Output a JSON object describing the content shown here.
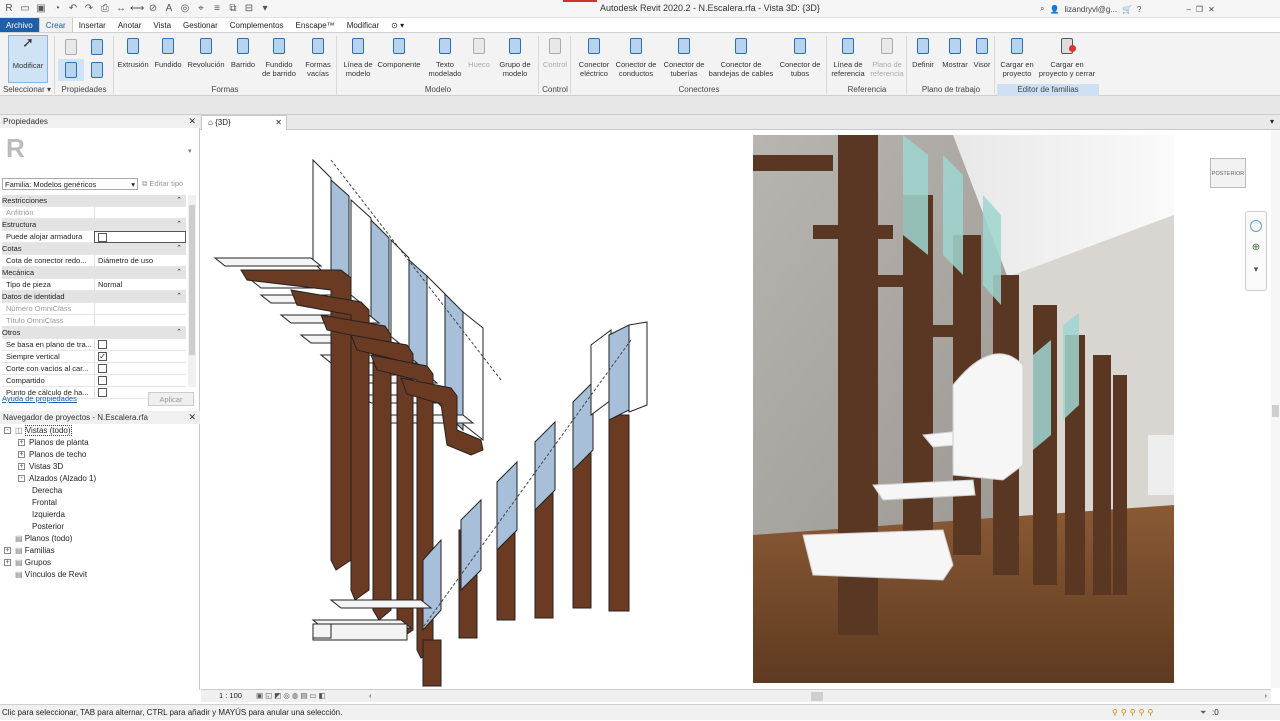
{
  "title_bar": {
    "title": "Autodesk Revit 2020.2 -  N.Escalera.rfa - Vista 3D: {3D}",
    "user": "lizandryvl@g...",
    "help": "?"
  },
  "menu": [
    "Archivo",
    "Crear",
    "Insertar",
    "Anotar",
    "Vista",
    "Gestionar",
    "Complementos",
    "Enscape™",
    "Modificar"
  ],
  "ribbon": {
    "modificar": "Modificar",
    "tools": [
      {
        "label": "Extrusión",
        "icon": "extrusion-icon"
      },
      {
        "label": "Fundido",
        "icon": "blend-icon"
      },
      {
        "label": "Revolución",
        "icon": "revolve-icon"
      },
      {
        "label": "Barrido",
        "icon": "sweep-icon"
      },
      {
        "label": "Fundido\nde barrido",
        "icon": "swept-blend-icon"
      },
      {
        "label": "Formas\nvacías",
        "icon": "void-forms-icon"
      },
      {
        "label": "Línea de\nmodelo",
        "icon": "model-line-icon"
      },
      {
        "label": "Componente",
        "icon": "component-icon"
      },
      {
        "label": "Texto\nmodelado",
        "icon": "model-text-icon"
      },
      {
        "label": "Hueco",
        "icon": "opening-icon"
      },
      {
        "label": "Grupo de\nmodelo",
        "icon": "model-group-icon"
      },
      {
        "label": "Control",
        "icon": "control-icon"
      },
      {
        "label": "Conector\neléctrico",
        "icon": "electrical-connector-icon"
      },
      {
        "label": "Conector de\nconductos",
        "icon": "duct-connector-icon"
      },
      {
        "label": "Conector de\ntuberías",
        "icon": "pipe-connector-icon"
      },
      {
        "label": "Conector de\nbandejas de cables",
        "icon": "cable-tray-connector-icon"
      },
      {
        "label": "Conector de\ntubos",
        "icon": "conduit-connector-icon"
      },
      {
        "label": "Línea de\nreferencia",
        "icon": "reference-line-icon"
      },
      {
        "label": "Plano de\nreferencia",
        "icon": "reference-plane-icon"
      },
      {
        "label": "Definir",
        "icon": "set-workplane-icon"
      },
      {
        "label": "Mostrar",
        "icon": "show-workplane-icon"
      },
      {
        "label": "Visor",
        "icon": "viewer-icon"
      },
      {
        "label": "Cargar en\nproyecto",
        "icon": "load-into-project-icon"
      },
      {
        "label": "Cargar en\nproyecto y cerrar",
        "icon": "load-and-close-icon"
      }
    ],
    "groups": [
      "Seleccionar ▾",
      "Propiedades",
      "Formas",
      "Modelo",
      "Control",
      "Conectores",
      "Referencia",
      "Plano de trabajo",
      "Editor de familias"
    ]
  },
  "properties": {
    "header": "Propiedades",
    "family_select": "Familia: Modelos genéricos",
    "edit_type": "Editar tipo",
    "rows": [
      {
        "k": "Restricciones",
        "cat": true
      },
      {
        "k": "Anfitrión",
        "v": "",
        "dim": true
      },
      {
        "k": "Estructura",
        "cat": true
      },
      {
        "k": "Puede alojar armadura",
        "chk": false
      },
      {
        "k": "Cotas",
        "cat": true
      },
      {
        "k": "Cota de conector redo...",
        "v": "Diámetro de uso"
      },
      {
        "k": "Mecánica",
        "cat": true
      },
      {
        "k": "Tipo de pieza",
        "v": "Normal"
      },
      {
        "k": "Datos de identidad",
        "cat": true
      },
      {
        "k": "Número OmniClass",
        "v": "",
        "dim": true
      },
      {
        "k": "Título OmniClass",
        "v": "",
        "dim": true
      },
      {
        "k": "Otros",
        "cat": true
      },
      {
        "k": "Se basa en plano de tra...",
        "chk": false
      },
      {
        "k": "Siempre vertical",
        "chk": true
      },
      {
        "k": "Corte con vacíos al car...",
        "chk": false
      },
      {
        "k": "Compartido",
        "chk": false
      },
      {
        "k": "Punto de cálculo de ha...",
        "chk": false
      }
    ],
    "help_link": "Ayuda de propiedades",
    "apply": "Aplicar"
  },
  "browser": {
    "header": "Navegador de proyectos - N.Escalera.rfa",
    "items": [
      {
        "label": "Vistas (todo)",
        "level": 0,
        "pm": "-",
        "icon": true
      },
      {
        "label": "Planos de planta",
        "level": 1,
        "pm": "+"
      },
      {
        "label": "Planos de techo",
        "level": 1,
        "pm": "+"
      },
      {
        "label": "Vistas 3D",
        "level": 1,
        "pm": "+"
      },
      {
        "label": "Alzados (Alzado 1)",
        "level": 1,
        "pm": "-"
      },
      {
        "label": "Derecha",
        "level": 2
      },
      {
        "label": "Frontal",
        "level": 2
      },
      {
        "label": "Izquierda",
        "level": 2
      },
      {
        "label": "Posterior",
        "level": 2
      },
      {
        "label": "Planos (todo)",
        "level": 0,
        "pm": ""
      },
      {
        "label": "Familias",
        "level": 0,
        "pm": "+"
      },
      {
        "label": "Grupos",
        "level": 0,
        "pm": "+"
      },
      {
        "label": "Vínculos de Revit",
        "level": 0,
        "pm": ""
      }
    ]
  },
  "view": {
    "tab": "{3D}",
    "scale": "1 : 100",
    "viewcube_face": "POSTERIOR"
  },
  "status": {
    "text": "Clic para seleccionar, TAB para alternar, CTRL para añadir y MAYÚS para anular una selección.",
    "filter_count": ":0"
  },
  "colors": {
    "accent": "#1f5fa8",
    "wood": "#6b3a22",
    "glass": "#9fb7d3",
    "editor_group": "#cfe0f4"
  }
}
